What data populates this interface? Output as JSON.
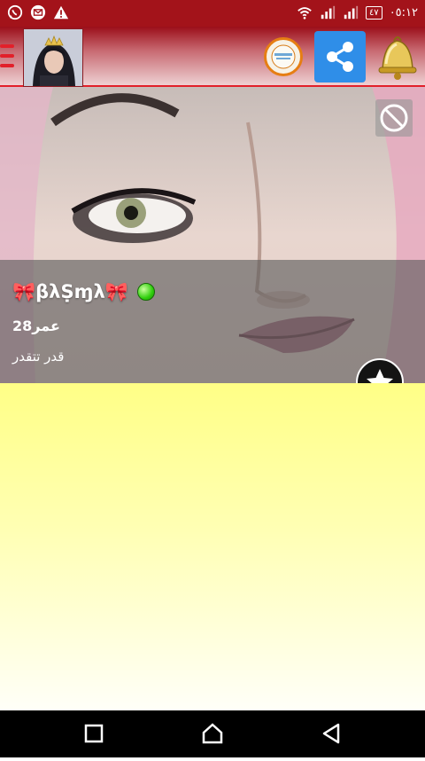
{
  "status_bar": {
    "left_icons": [
      "whatsapp-icon",
      "email-icon",
      "warning-icon"
    ],
    "right_icons": [
      "wifi-icon",
      "signal-icon",
      "signal-icon",
      "battery-icon"
    ],
    "battery_label": "٤٧",
    "time": "٠٥:١٢"
  },
  "header": {
    "menu_icon": "hamburger-menu-icon",
    "avatar": "profile-avatar",
    "live_button_icon": "live-broadcast-icon",
    "share_icon": "share-icon",
    "bell_icon": "bell-icon"
  },
  "profile": {
    "name": "🎀βλṢɱλ🎀",
    "online": true,
    "age": "28عمر",
    "status": "قدر تتقدر",
    "block_icon": "block-icon",
    "favorite_icon": "star-icon"
  },
  "colors": {
    "status_bar": "#a3131a",
    "accent_red": "#e2202a",
    "share_blue": "#2f8ee8",
    "online_green": "#2fcf0d",
    "content_yellow": "#ffff86"
  },
  "navbar": [
    "recent-apps-icon",
    "home-icon",
    "back-icon"
  ]
}
